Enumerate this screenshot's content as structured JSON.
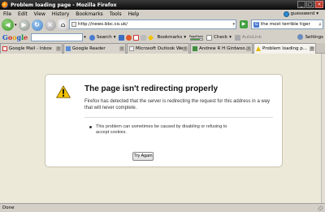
{
  "window": {
    "title": "Problem loading page - Mozilla Firefox"
  },
  "menubar": {
    "items": [
      "File",
      "Edit",
      "View",
      "History",
      "Bookmarks",
      "Tools",
      "Help"
    ],
    "user": "guesswerd"
  },
  "navbar": {
    "url": "http://news.bbc.co.uk/",
    "search_value": "the most terrible tiger"
  },
  "google_toolbar": {
    "logo": "Google",
    "search_label": "Search",
    "bookmarks_label": "Bookmarks",
    "pagerank_label": "PageRank",
    "check_label": "Check",
    "autolink_label": "AutoLink",
    "settings_label": "Settings"
  },
  "tabs": [
    {
      "label": "Google Mail - Inbox",
      "icon": "gmail-icon",
      "active": false
    },
    {
      "label": "Google Reader",
      "icon": "reader-icon",
      "active": false
    },
    {
      "label": "Microsoft Outlook We...",
      "icon": "outlook-icon",
      "active": false
    },
    {
      "label": "Andrew R H Girdwoo...",
      "icon": "wordpress-icon",
      "active": false
    },
    {
      "label": "Problem loading p...",
      "icon": "warning-icon",
      "active": true
    }
  ],
  "error": {
    "title": "The page isn't redirecting properly",
    "description": "Firefox has detected that the server is redirecting the request for this address in a way that will never complete.",
    "bullet": "This problem can sometimes be caused by disabling or refusing to accept cookies.",
    "button": "Try Again"
  },
  "status": {
    "text": "Done"
  },
  "colors": {
    "titlebar": "#0a0a0a",
    "chrome": "#d4d0c8",
    "content_bg": "#ece9d8",
    "go_green": "#44a040"
  }
}
